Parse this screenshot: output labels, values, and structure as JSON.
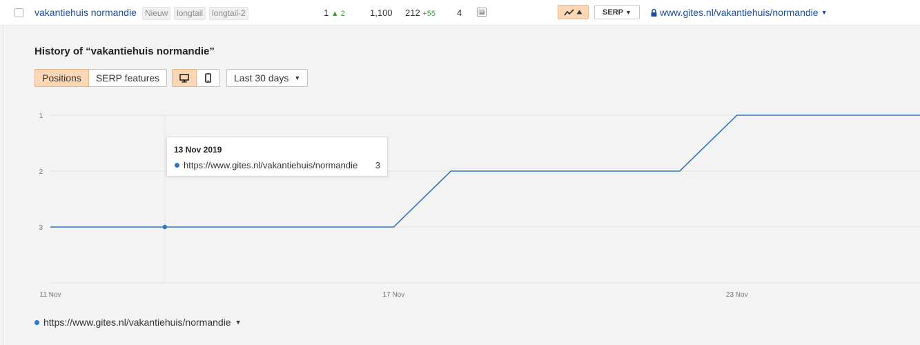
{
  "row": {
    "keyword": "vakantiehuis normandie",
    "tags": [
      "Nieuw",
      "longtail",
      "longtail-2"
    ],
    "position": "1",
    "position_change": "▲ 2",
    "volume": "1,100",
    "traffic": "212",
    "traffic_change": "+55",
    "kd": "4",
    "serp_label": "SERP",
    "url": "www.gites.nl/vakantiehuis/normandie"
  },
  "history": {
    "title": "History of “vakantiehuis normandie”",
    "tabs": [
      "Positions",
      "SERP features"
    ],
    "range": "Last 30 days"
  },
  "tooltip": {
    "date": "13 Nov 2019",
    "url": "https://www.gites.nl/vakantiehuis/normandie",
    "value": "3"
  },
  "legend": {
    "label": "https://www.gites.nl/vakantiehuis/normandie"
  },
  "colors": {
    "accent": "#fcd7b5",
    "line": "#2f74c6",
    "link": "#1d4e9c"
  },
  "chart_data": {
    "type": "line",
    "title": "History of “vakantiehuis normandie”",
    "y_ticks": [
      "1",
      "2",
      "3"
    ],
    "y_reversed": true,
    "ylim": [
      1,
      4
    ],
    "x_ticks": [
      "11 Nov",
      "17 Nov",
      "23 Nov"
    ],
    "x_tick_days": [
      11,
      17,
      23
    ],
    "xlim": [
      11,
      26.2
    ],
    "series": [
      {
        "name": "https://www.gites.nl/vakantiehuis/normandie",
        "x": [
          11,
          13,
          17,
          18,
          22,
          23,
          26.2
        ],
        "y": [
          3,
          3,
          3,
          2,
          2,
          1,
          1
        ]
      }
    ],
    "highlight": {
      "x": 13,
      "y": 3
    },
    "grid": true
  }
}
